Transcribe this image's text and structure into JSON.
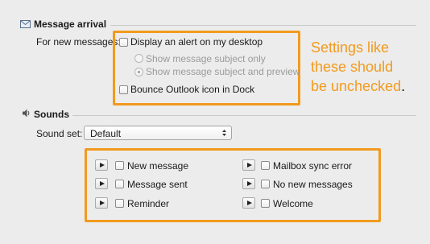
{
  "message_arrival": {
    "title": "Message arrival",
    "for_new_messages_label": "For new messages:",
    "display_alert_label": "Display an alert on my desktop",
    "subject_only_label": "Show message subject only",
    "subject_preview_label": "Show message subject and preview",
    "bounce_label": "Bounce Outlook icon in Dock"
  },
  "annotation": {
    "lines": [
      "Settings like",
      "these should",
      "be unchecked"
    ],
    "period": ".",
    "color": "#f29a1e"
  },
  "sounds": {
    "title": "Sounds",
    "sound_set_label": "Sound set:",
    "sound_set_value": "Default",
    "items": [
      {
        "label": "New message"
      },
      {
        "label": "Message sent"
      },
      {
        "label": "Reminder"
      },
      {
        "label": "Mailbox sync error"
      },
      {
        "label": "No new messages"
      },
      {
        "label": "Welcome"
      }
    ]
  }
}
